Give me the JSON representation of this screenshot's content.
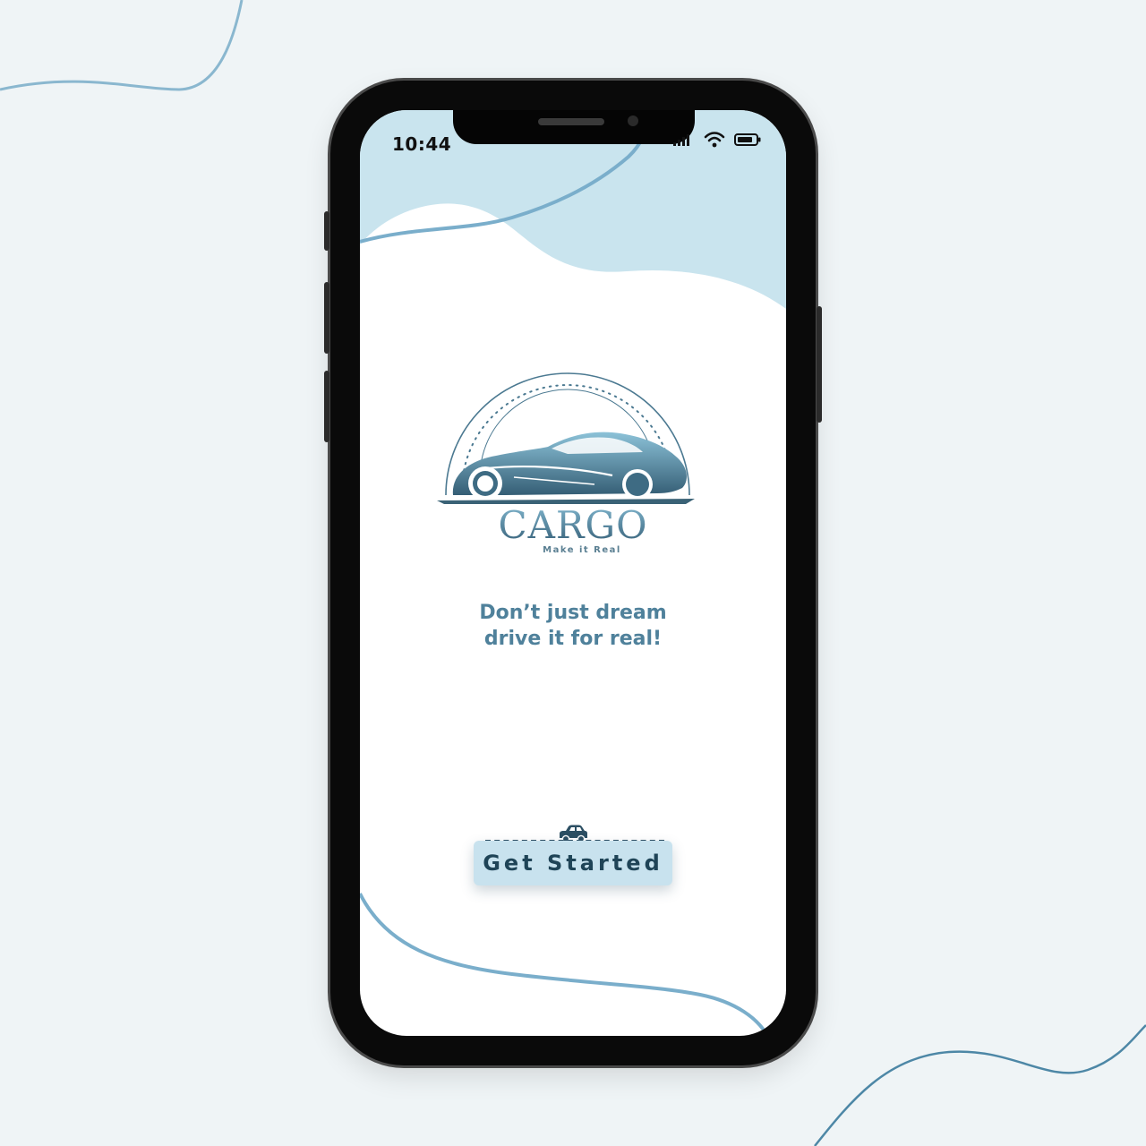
{
  "status_bar": {
    "time": "10:44",
    "icons": [
      "signal-icon",
      "wifi-icon",
      "battery-icon"
    ]
  },
  "brand": {
    "name": "CARGO",
    "tagline": "Make it Real"
  },
  "headline": {
    "line1": "Don’t just dream",
    "line2": "drive it for real!"
  },
  "cta": {
    "label": "Get Started"
  },
  "colors": {
    "background": "#eff4f6",
    "accent_light": "#c8e2ee",
    "accent": "#4f819b",
    "accent_dark": "#1f4457",
    "curve": "#7aaecb"
  }
}
